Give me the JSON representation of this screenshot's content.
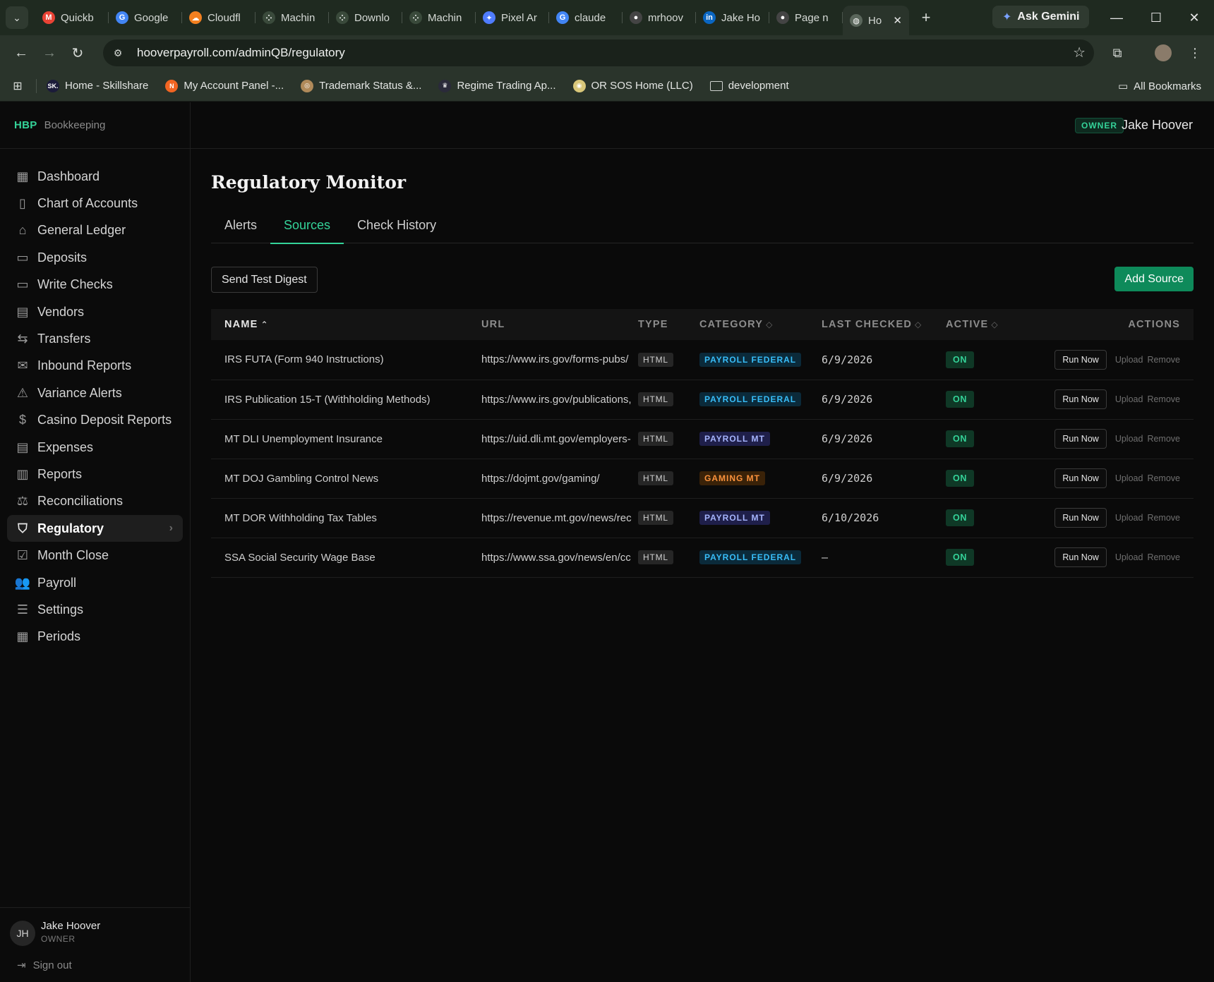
{
  "browser": {
    "tabs": [
      {
        "label": "Quickb",
        "icon": "gmail-icon",
        "color": "#ea4335",
        "glyph": "M"
      },
      {
        "label": "Google",
        "icon": "google-icon",
        "color": "#4285f4",
        "glyph": "G"
      },
      {
        "label": "Cloudfl",
        "icon": "cloudflare-icon",
        "color": "#f38020",
        "glyph": "☁"
      },
      {
        "label": "Machin",
        "icon": "app-icon",
        "color": "#3a4a3b",
        "glyph": "⁘"
      },
      {
        "label": "Downlo",
        "icon": "app-icon",
        "color": "#3a4a3b",
        "glyph": "⁘"
      },
      {
        "label": "Machin",
        "icon": "app-icon",
        "color": "#3a4a3b",
        "glyph": "⁘"
      },
      {
        "label": "Pixel Ar",
        "icon": "gemini-icon",
        "color": "#4f7cff",
        "glyph": "✦"
      },
      {
        "label": "claude",
        "icon": "google-icon",
        "color": "#4285f4",
        "glyph": "G"
      },
      {
        "label": "mrhoov",
        "icon": "github-icon",
        "color": "#444444",
        "glyph": "●"
      },
      {
        "label": "Jake Ho",
        "icon": "linkedin-icon",
        "color": "#0a66c2",
        "glyph": "in"
      },
      {
        "label": "Page n",
        "icon": "github-icon",
        "color": "#444444",
        "glyph": "●"
      }
    ],
    "active_tab": {
      "label": "Ho",
      "icon": "globe-icon"
    },
    "ask_gemini": "Ask Gemini",
    "url": "hooverpayroll.com/adminQB/regulatory",
    "bookmarks": [
      {
        "label": "Home - Skillshare",
        "icon": "skillshare-icon",
        "color": "#1b1b3a",
        "glyph": "SK."
      },
      {
        "label": "My Account Panel -...",
        "icon": "account-panel-icon",
        "color": "#f26522",
        "glyph": "N"
      },
      {
        "label": "Trademark Status &...",
        "icon": "uspto-icon",
        "color": "#b08a5a",
        "glyph": "◎"
      },
      {
        "label": "Regime Trading Ap...",
        "icon": "crown-icon",
        "color": "#2a2a3a",
        "glyph": "♛"
      },
      {
        "label": "OR SOS Home (LLC)",
        "icon": "oregon-seal-icon",
        "color": "#d9c77a",
        "glyph": "◉"
      },
      {
        "label": "development",
        "icon": "folder-icon",
        "color": "transparent",
        "glyph": "▭"
      }
    ],
    "all_bookmarks": "All Bookmarks"
  },
  "app": {
    "brand_mark": "HBP",
    "brand_name": "Bookkeeping",
    "top_role_badge": "OWNER",
    "top_user_name": "Jake Hoover",
    "nav": [
      {
        "label": "Dashboard",
        "icon": "dashboard-icon",
        "glyph": "▦"
      },
      {
        "label": "Chart of Accounts",
        "icon": "book-icon",
        "glyph": "▯"
      },
      {
        "label": "General Ledger",
        "icon": "bank-icon",
        "glyph": "⌂"
      },
      {
        "label": "Deposits",
        "icon": "cash-icon",
        "glyph": "▭"
      },
      {
        "label": "Write Checks",
        "icon": "credit-card-icon",
        "glyph": "▭"
      },
      {
        "label": "Vendors",
        "icon": "building-icon",
        "glyph": "▤"
      },
      {
        "label": "Transfers",
        "icon": "arrows-left-right-icon",
        "glyph": "⇆"
      },
      {
        "label": "Inbound Reports",
        "icon": "mail-icon",
        "glyph": "✉"
      },
      {
        "label": "Variance Alerts",
        "icon": "warning-icon",
        "glyph": "⚠"
      },
      {
        "label": "Casino Deposit Reports",
        "icon": "dollar-file-icon",
        "glyph": "$"
      },
      {
        "label": "Expenses",
        "icon": "receipt-icon",
        "glyph": "▤"
      },
      {
        "label": "Reports",
        "icon": "bar-chart-icon",
        "glyph": "▥"
      },
      {
        "label": "Reconciliations",
        "icon": "scale-icon",
        "glyph": "⚖"
      },
      {
        "label": "Regulatory",
        "icon": "shield-icon",
        "glyph": "⛉",
        "active": true
      },
      {
        "label": "Month Close",
        "icon": "clipboard-check-icon",
        "glyph": "☑"
      },
      {
        "label": "Payroll",
        "icon": "users-icon",
        "glyph": "👥"
      },
      {
        "label": "Settings",
        "icon": "sliders-icon",
        "glyph": "☰"
      },
      {
        "label": "Periods",
        "icon": "calendar-icon",
        "glyph": "▦"
      }
    ],
    "footer": {
      "initials": "JH",
      "name": "Jake Hoover",
      "role": "OWNER",
      "sign_out": "Sign out"
    }
  },
  "page": {
    "title": "Regulatory Monitor",
    "tabs": [
      {
        "label": "Alerts",
        "active": false
      },
      {
        "label": "Sources",
        "active": true
      },
      {
        "label": "Check History",
        "active": false
      }
    ],
    "send_test_digest": "Send Test Digest",
    "add_source": "Add Source",
    "columns": {
      "name": "NAME",
      "url": "URL",
      "type": "TYPE",
      "category": "CATEGORY",
      "last_checked": "LAST CHECKED",
      "active": "ACTIVE",
      "actions": "ACTIONS"
    },
    "category_colors": {
      "PAYROLL FEDERAL": {
        "bg": "#0b2a3a",
        "fg": "#38bdf8"
      },
      "PAYROLL MT": {
        "bg": "#1f1f4a",
        "fg": "#a5b4fc"
      },
      "GAMING MT": {
        "bg": "#3a2208",
        "fg": "#fb923c"
      }
    },
    "action_labels": {
      "run": "Run Now",
      "upload": "Upload",
      "remove": "Remove"
    },
    "rows": [
      {
        "name": "IRS FUTA (Form 940 Instructions)",
        "url": "https://www.irs.gov/forms-pubs/",
        "type": "HTML",
        "category": "PAYROLL FEDERAL",
        "last_checked": "6/9/2026",
        "active": "ON"
      },
      {
        "name": "IRS Publication 15-T (Withholding Methods)",
        "url": "https://www.irs.gov/publications,",
        "type": "HTML",
        "category": "PAYROLL FEDERAL",
        "last_checked": "6/9/2026",
        "active": "ON"
      },
      {
        "name": "MT DLI Unemployment Insurance",
        "url": "https://uid.dli.mt.gov/employers-",
        "type": "HTML",
        "category": "PAYROLL MT",
        "last_checked": "6/9/2026",
        "active": "ON"
      },
      {
        "name": "MT DOJ Gambling Control News",
        "url": "https://dojmt.gov/gaming/",
        "type": "HTML",
        "category": "GAMING MT",
        "last_checked": "6/9/2026",
        "active": "ON"
      },
      {
        "name": "MT DOR Withholding Tax Tables",
        "url": "https://revenue.mt.gov/news/rec",
        "type": "HTML",
        "category": "PAYROLL MT",
        "last_checked": "6/10/2026",
        "active": "ON"
      },
      {
        "name": "SSA Social Security Wage Base",
        "url": "https://www.ssa.gov/news/en/cc",
        "type": "HTML",
        "category": "PAYROLL FEDERAL",
        "last_checked": "–",
        "active": "ON"
      }
    ]
  }
}
